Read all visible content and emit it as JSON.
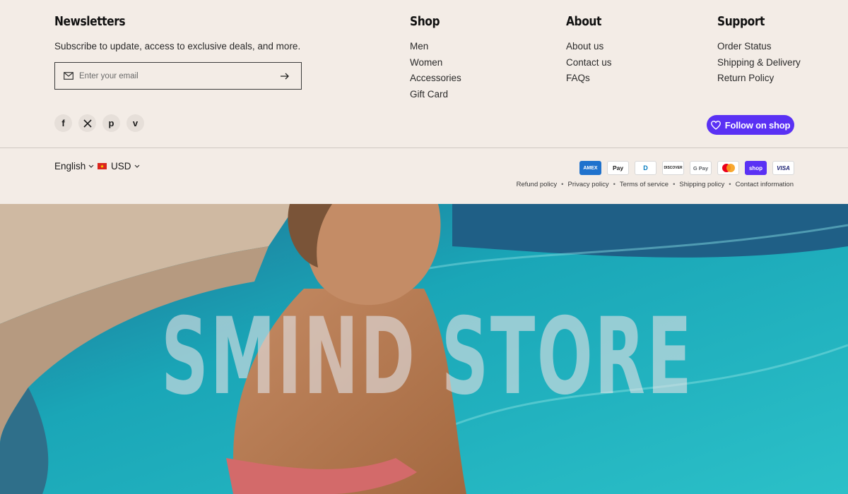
{
  "newsletter": {
    "title": "Newsletters",
    "description": "Subscribe to update, access to exclusive deals, and more.",
    "email_placeholder": "Enter your email"
  },
  "social_icons": [
    "facebook-icon",
    "x-icon",
    "pinterest-icon",
    "vimeo-icon"
  ],
  "shop": {
    "title": "Shop",
    "items": [
      "Men",
      "Women",
      "Accessories",
      "Gift Card"
    ]
  },
  "about": {
    "title": "About",
    "items": [
      "About us",
      "Contact us",
      "FAQs"
    ]
  },
  "support": {
    "title": "Support",
    "items": [
      "Order Status",
      "Shipping & Delivery",
      "Return Policy"
    ]
  },
  "follow_button": "Follow on shop",
  "locale": {
    "language": "English",
    "currency": "USD"
  },
  "payment_methods": [
    "AMEX",
    "Pay",
    "D",
    "DISCOVER",
    "G Pay",
    "mastercard",
    "shop",
    "VISA"
  ],
  "policies": [
    "Refund policy",
    "Privacy policy",
    "Terms of service",
    "Shipping policy",
    "Contact information"
  ],
  "hero": {
    "title": "SMIND STORE"
  },
  "colors": {
    "background": "#f3ece6",
    "shop_purple": "#5a31f4",
    "pool": "#1aa7b5"
  }
}
